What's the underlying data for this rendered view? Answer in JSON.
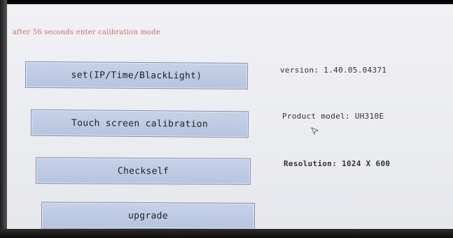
{
  "countdown_text": "after 56 seconds enter calibration mode",
  "buttons": {
    "set_label": "set(IP/Time/BlackLight)",
    "calibration_label": "Touch screen calibration",
    "checkself_label": "Checkself",
    "upgrade_label": "upgrade"
  },
  "info": {
    "version": "version: 1.40.05.04371",
    "model": "Product model: UH310E",
    "resolution": "Resolution: 1024 X 600"
  },
  "icons": {
    "cursor": "cursor-arrow-icon"
  },
  "colors": {
    "countdown": "#d56a70",
    "button_fill": "#b9c6e0",
    "button_border": "#7b8bab",
    "screen_bg": "#eceef2"
  }
}
